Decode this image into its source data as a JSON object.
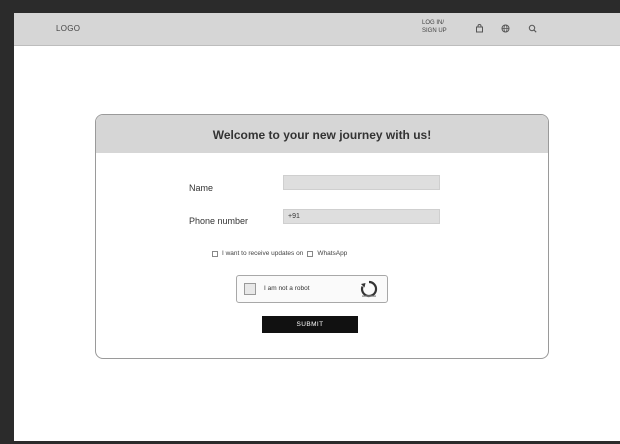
{
  "navbar": {
    "logo": "LOGO",
    "login_line1": "LOG IN/",
    "login_line2": "SIGN UP",
    "icons": [
      "shopping-bag-icon",
      "globe-icon",
      "search-icon"
    ]
  },
  "form": {
    "title": "Welcome to your new journey with us!",
    "name_label": "Name",
    "name_value": "",
    "phone_label": "Phone number",
    "phone_prefix": "+91",
    "consent_text": "I want to receive updates on",
    "whatsapp_label": "WhatsApp",
    "captcha_text": "I am not a robot",
    "submit_label": "SUBMIT"
  }
}
